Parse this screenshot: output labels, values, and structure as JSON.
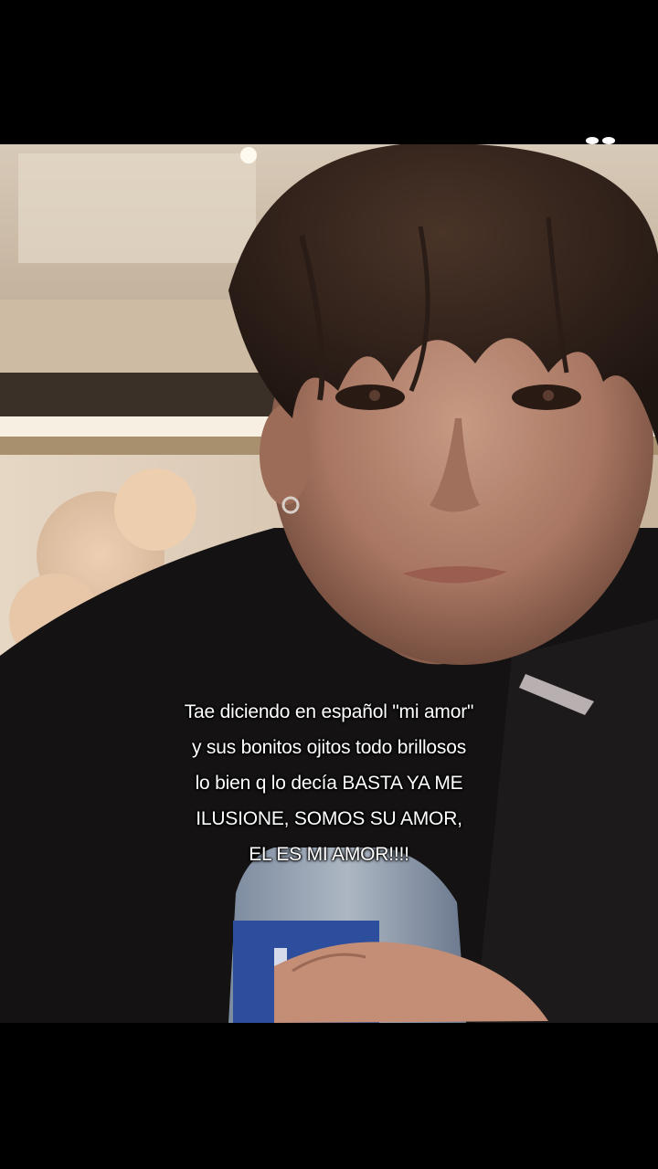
{
  "caption": {
    "lines": [
      "Tae diciendo en español \"mi amor\"",
      "y sus bonitos ojitos todo brillosos",
      "lo bien q lo decía BASTA YA ME",
      "ILUSIONE, SOMOS SU AMOR,",
      "EL ES MI AMOR!!!!"
    ]
  },
  "video": {
    "description_icon": "video-frame-icon"
  },
  "colors": {
    "background": "#000000",
    "caption_text": "#ffffff"
  }
}
